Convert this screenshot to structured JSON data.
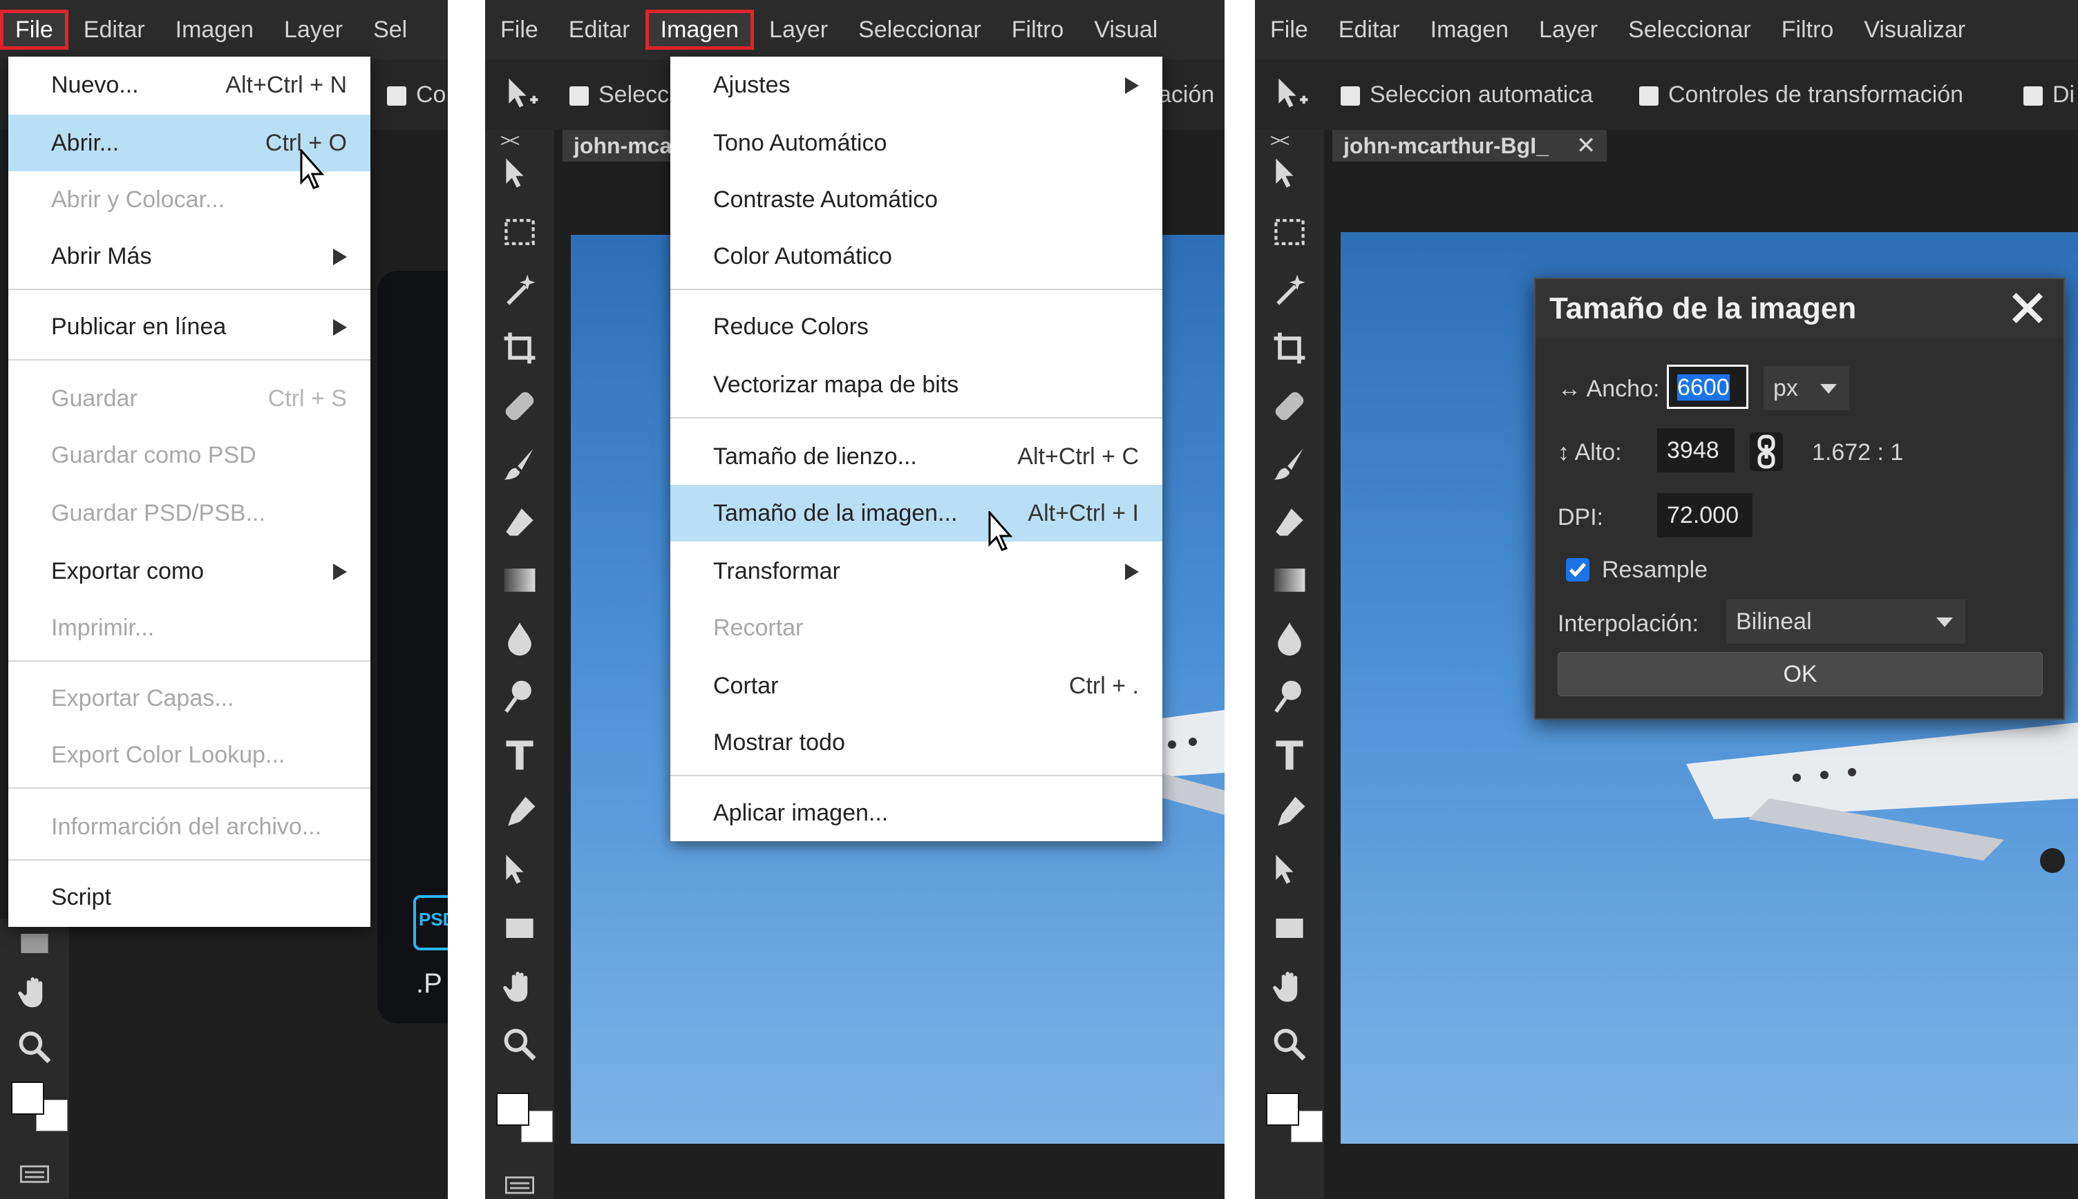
{
  "panel1": {
    "menubar": [
      "File",
      "Editar",
      "Imagen",
      "Layer",
      "Sel"
    ],
    "option_label": "Co",
    "file_menu": [
      {
        "label": "Nuevo...",
        "shortcut": "Alt+Ctrl + N"
      },
      {
        "label": "Abrir...",
        "shortcut": "Ctrl + O"
      },
      {
        "label": "Abrir y Colocar..."
      },
      {
        "label": "Abrir Más"
      },
      {
        "label": "Publicar en línea"
      },
      {
        "label": "Guardar",
        "shortcut": "Ctrl + S"
      },
      {
        "label": "Guardar como PSD"
      },
      {
        "label": "Guardar PSD/PSB..."
      },
      {
        "label": "Exportar como"
      },
      {
        "label": "Imprimir..."
      },
      {
        "label": "Exportar Capas..."
      },
      {
        "label": "Export Color Lookup..."
      },
      {
        "label": "Informarción del archivo..."
      },
      {
        "label": "Script"
      }
    ],
    "logo_text": "PSD",
    "logo_sub": ".P"
  },
  "panel2": {
    "menubar": [
      "File",
      "Editar",
      "Imagen",
      "Layer",
      "Seleccionar",
      "Filtro",
      "Visual"
    ],
    "option_label": "Selecc",
    "option_label_right": "ación",
    "doc_tab": "john-mca",
    "imagen_menu": [
      {
        "label": "Ajustes"
      },
      {
        "label": "Tono Automático"
      },
      {
        "label": "Contraste Automático"
      },
      {
        "label": "Color Automático"
      },
      {
        "label": "Reduce Colors"
      },
      {
        "label": "Vectorizar mapa de bits"
      },
      {
        "label": "Tamaño de lienzo...",
        "shortcut": "Alt+Ctrl + C"
      },
      {
        "label": "Tamaño de la imagen...",
        "shortcut": "Alt+Ctrl + I"
      },
      {
        "label": "Transformar"
      },
      {
        "label": "Recortar"
      },
      {
        "label": "Cortar",
        "shortcut": "Ctrl + ."
      },
      {
        "label": "Mostrar todo"
      },
      {
        "label": "Aplicar imagen..."
      }
    ]
  },
  "panel3": {
    "menubar": [
      "File",
      "Editar",
      "Imagen",
      "Layer",
      "Seleccionar",
      "Filtro",
      "Visualizar"
    ],
    "options": [
      "Seleccion automatica",
      "Controles de transformación",
      "Di"
    ],
    "doc_tab": "john-mcarthur-BgI_",
    "dialog": {
      "title": "Tamaño de la imagen",
      "width_label": "Ancho:",
      "width_value": "6600",
      "unit": "px",
      "height_label": "Alto:",
      "height_value": "3948",
      "ratio": "1.672 : 1",
      "dpi_label": "DPI:",
      "dpi_value": "72.000",
      "resample_label": "Resample",
      "resample_checked": true,
      "interp_label": "Interpolación:",
      "interp_value": "Bilineal",
      "ok_label": "OK"
    }
  },
  "colors": {
    "menu_highlight": "#b9dff5",
    "red_outline": "#e0242b",
    "focus_blue": "#1a73e8",
    "sky": "#4a8fd6"
  },
  "icons": [
    "move-tool-icon",
    "marquee-icon",
    "magic-wand-icon",
    "crop-icon",
    "healing-icon",
    "brush-icon",
    "eraser-icon",
    "gradient-icon",
    "drop-icon",
    "dodge-icon",
    "type-icon",
    "pen-icon",
    "path-select-icon",
    "shape-icon",
    "hand-icon",
    "zoom-icon",
    "chevron-right-icon",
    "close-icon",
    "chain-link-icon",
    "chevron-down-icon",
    "arrow-cursor-icon"
  ]
}
